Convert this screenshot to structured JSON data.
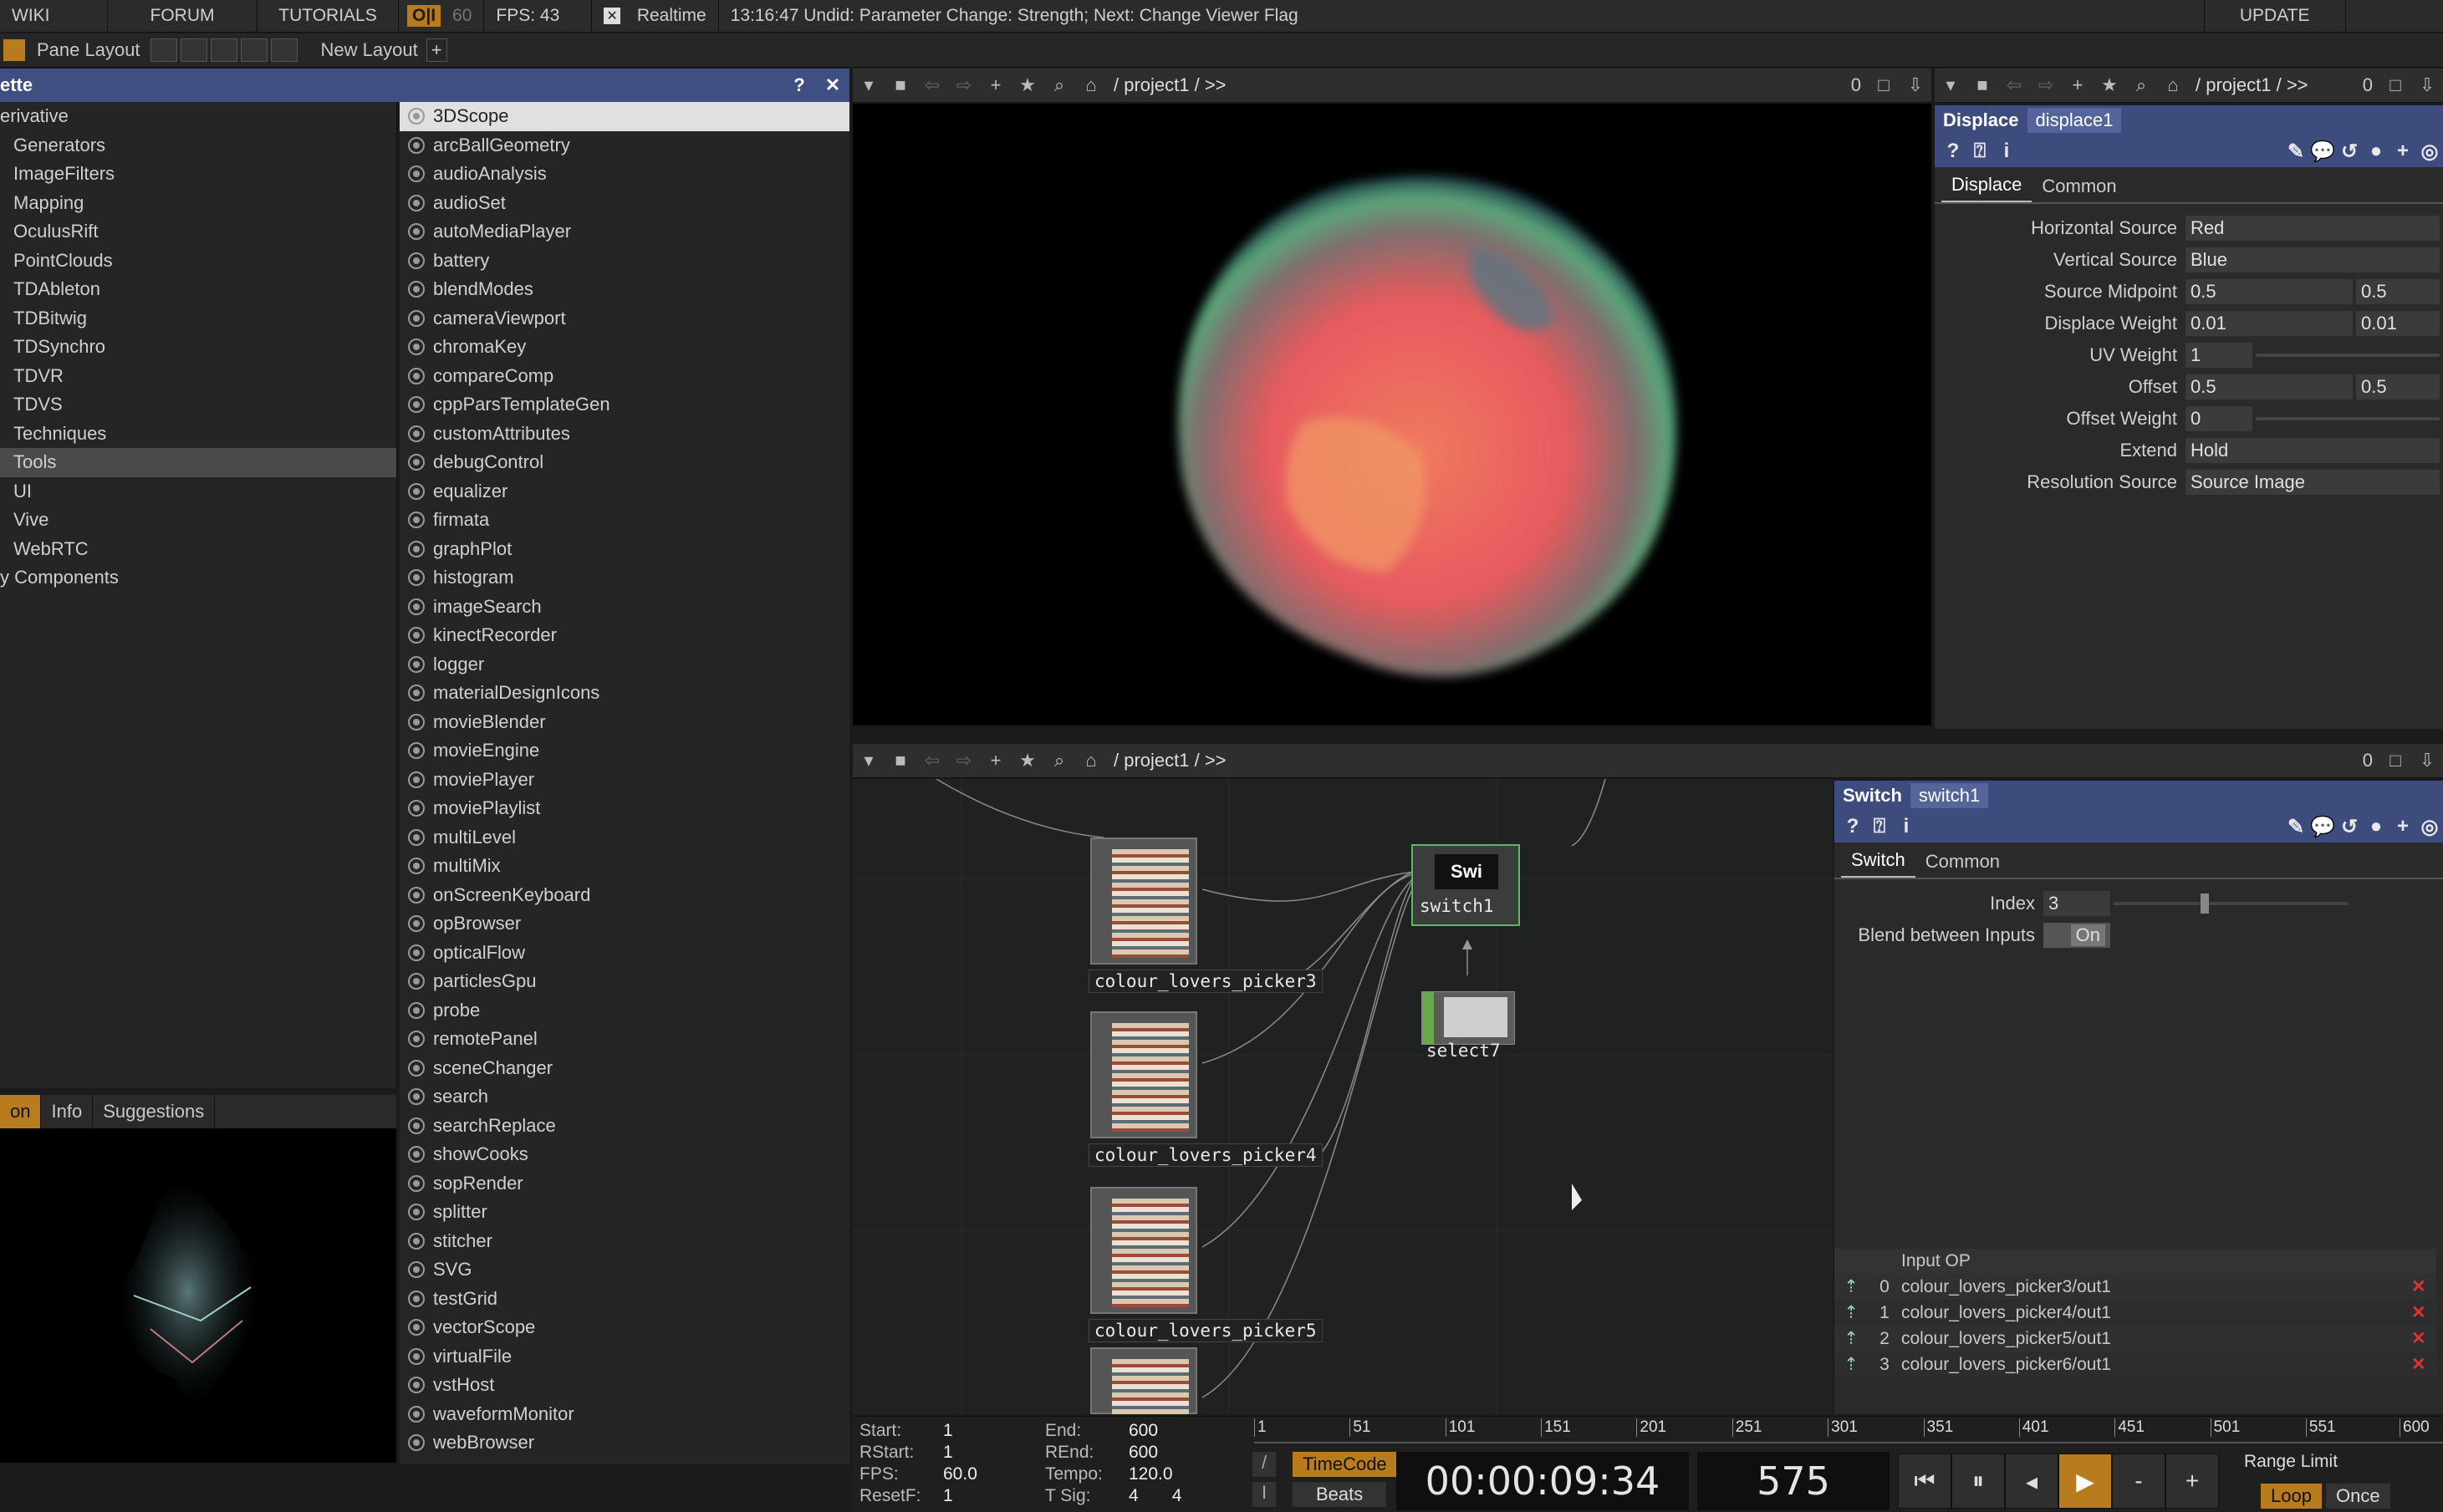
{
  "topbar": {
    "items": [
      "WIKI",
      "FORUM",
      "TUTORIALS"
    ],
    "perf": "O|I",
    "fps_cap": "60",
    "fps": "FPS: 43",
    "realtime_check": "✕",
    "realtime": "Realtime",
    "status": "13:16:47 Undid: Parameter Change: Strength; Next: Change Viewer Flag",
    "update": "UPDATE"
  },
  "layoutbar": {
    "pane_layout": "Pane Layout",
    "new_layout": "New Layout",
    "plus": "+"
  },
  "palette": {
    "title": "ette",
    "help": "?",
    "close": "✕",
    "categories": [
      "erivative",
      "Generators",
      "ImageFilters",
      "Mapping",
      "OculusRift",
      "PointClouds",
      "TDAbleton",
      "TDBitwig",
      "TDSynchro",
      "TDVR",
      "TDVS",
      "Techniques",
      "Tools",
      "UI",
      "Vive",
      "WebRTC",
      "y Components"
    ],
    "selected_category": "Tools",
    "components": [
      "3DScope",
      "arcBallGeometry",
      "audioAnalysis",
      "audioSet",
      "autoMediaPlayer",
      "battery",
      "blendModes",
      "cameraViewport",
      "chromaKey",
      "compareComp",
      "cppParsTemplateGen",
      "customAttributes",
      "debugControl",
      "equalizer",
      "firmata",
      "graphPlot",
      "histogram",
      "imageSearch",
      "kinectRecorder",
      "logger",
      "materialDesignIcons",
      "movieBlender",
      "movieEngine",
      "moviePlayer",
      "moviePlaylist",
      "multiLevel",
      "multiMix",
      "onScreenKeyboard",
      "opBrowser",
      "opticalFlow",
      "particlesGpu",
      "probe",
      "remotePanel",
      "sceneChanger",
      "search",
      "searchReplace",
      "showCooks",
      "sopRender",
      "splitter",
      "stitcher",
      "SVG",
      "testGrid",
      "vectorScope",
      "virtualFile",
      "vstHost",
      "waveformMonitor",
      "webBrowser"
    ],
    "selected_component": "3DScope",
    "bottom_tabs": [
      "on",
      "Info",
      "Suggestions"
    ]
  },
  "viewer_pane": {
    "path": "/ project1 / >>",
    "number": "0"
  },
  "param_pane_top": {
    "path": "/ project1 / >>",
    "number": "0"
  },
  "network_pane": {
    "path": "/ project1 / >>",
    "number": "0"
  },
  "displace": {
    "type": "Displace",
    "name": "displace1",
    "tabs": [
      "Displace",
      "Common"
    ],
    "params": [
      {
        "label": "Horizontal Source",
        "v1": "Red",
        "v2": ""
      },
      {
        "label": "Vertical Source",
        "v1": "Blue",
        "v2": ""
      },
      {
        "label": "Source Midpoint",
        "v1": "0.5",
        "v2": "0.5"
      },
      {
        "label": "Displace Weight",
        "v1": "0.01",
        "v2": "0.01"
      },
      {
        "label": "UV Weight",
        "v1": "1",
        "v2": ""
      },
      {
        "label": "Offset",
        "v1": "0.5",
        "v2": "0.5"
      },
      {
        "label": "Offset Weight",
        "v1": "0",
        "v2": ""
      },
      {
        "label": "Extend",
        "v1": "Hold",
        "v2": ""
      },
      {
        "label": "Resolution Source",
        "v1": "Source Image",
        "v2": ""
      }
    ]
  },
  "switch": {
    "type": "Switch",
    "name": "switch1",
    "tabs": [
      "Switch",
      "Common"
    ],
    "index_label": "Index",
    "index_value": "3",
    "blend_label": "Blend between Inputs",
    "blend_value": "On",
    "input_header": "Input OP",
    "inputs": [
      {
        "idx": "0",
        "op": "colour_lovers_picker3/out1"
      },
      {
        "idx": "1",
        "op": "colour_lovers_picker4/out1"
      },
      {
        "idx": "2",
        "op": "colour_lovers_picker5/out1"
      },
      {
        "idx": "3",
        "op": "colour_lovers_picker6/out1"
      }
    ]
  },
  "network": {
    "nodes": [
      "colour_lovers_picker3",
      "colour_lovers_picker4",
      "colour_lovers_picker5"
    ],
    "switch_label": "switch1",
    "switch_badge": "Swi",
    "select_label": "select7"
  },
  "timeline": {
    "start_k": "Start:",
    "start_v": "1",
    "rstart_k": "RStart:",
    "rstart_v": "1",
    "fps_k": "FPS:",
    "fps_v": "60.0",
    "resetf_k": "ResetF:",
    "resetf_v": "1",
    "end_k": "End:",
    "end_v": "600",
    "rend_k": "REnd:",
    "rend_v": "600",
    "tempo_k": "Tempo:",
    "tempo_v": "120.0",
    "tsig_k": "T Sig:",
    "tsig_v1": "4",
    "tsig_v2": "4",
    "ruler": [
      "1",
      "51",
      "101",
      "151",
      "201",
      "251",
      "301",
      "351",
      "401",
      "451",
      "501",
      "551",
      "600"
    ],
    "timecode_btn": "TimeCode",
    "beats_btn": "Beats",
    "timecode": "00:00:09:34",
    "frame": "575",
    "minus": "-",
    "plus": "+",
    "range_limit": "Range Limit",
    "loop": "Loop",
    "once": "Once"
  },
  "colors": {
    "accent": "#b87c1f",
    "title_bar": "#3e4c7d"
  }
}
